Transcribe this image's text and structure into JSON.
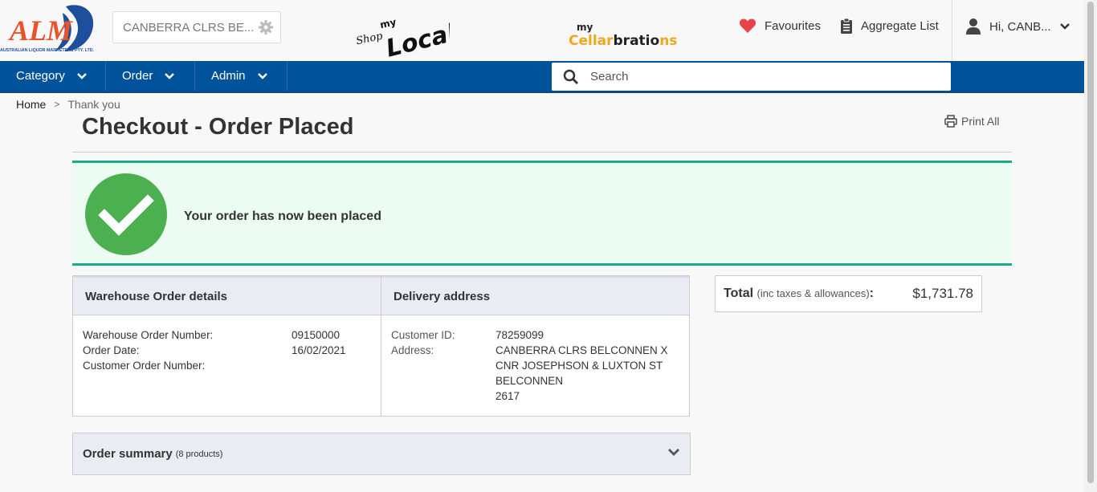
{
  "header": {
    "store_selector": "CANBERRA CLRS BE...",
    "favourites_label": "Favourites",
    "aggregate_label": "Aggregate List",
    "user_greeting": "Hi, CANB...",
    "logo_alm_text": "ALM",
    "logo_alm_subtext": "AUSTRALIAN LIQUOR MARKETERS PTY. LTD.",
    "logo_shoplocal_text": "Shop myLocal",
    "logo_cellar_text": "my Cellarbrations"
  },
  "nav": {
    "items": [
      "Category",
      "Order",
      "Admin"
    ],
    "search_placeholder": "Search"
  },
  "breadcrumb": {
    "home": "Home",
    "separator": ">",
    "current": "Thank you"
  },
  "page": {
    "title": "Checkout - Order Placed",
    "print_all": "Print All"
  },
  "success": {
    "message": "Your order has now been placed"
  },
  "warehouse": {
    "heading": "Warehouse Order details",
    "order_number_label": "Warehouse Order Number:",
    "order_number": "09150000",
    "order_date_label": "Order Date:",
    "order_date": "16/02/2021",
    "customer_order_label": "Customer Order Number:"
  },
  "delivery": {
    "heading": "Delivery address",
    "customer_id_label": "Customer ID:",
    "customer_id": "78259099",
    "address_label": "Address:",
    "address_line1": "CANBERRA CLRS BELCONNEN X",
    "address_line2": "CNR JOSEPHSON & LUXTON ST",
    "address_line3": "BELCONNEN",
    "address_line4": "2617"
  },
  "total": {
    "label": "Total",
    "sublabel": "(inc taxes & allowances)",
    "colon": ":",
    "amount": "$1,731.78"
  },
  "summary": {
    "title": "Order summary",
    "count": "(8 products)"
  },
  "colors": {
    "nav_blue": "#00539b",
    "success_green": "#4caf50",
    "success_border": "#1aab8a",
    "heart_red": "#e8434b"
  }
}
